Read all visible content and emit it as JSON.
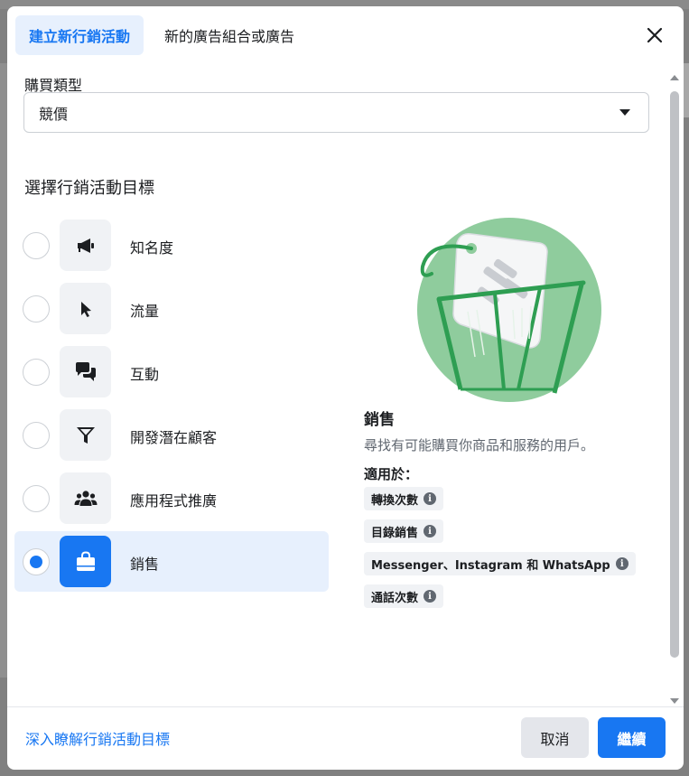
{
  "tabs": [
    {
      "label": "建立新行銷活動",
      "active": true
    },
    {
      "label": "新的廣告組合或廣告",
      "active": false
    }
  ],
  "buy_type": {
    "label": "購買類型",
    "value": "競價"
  },
  "objective_section": {
    "title": "選擇行銷活動目標",
    "items": [
      {
        "label": "知名度",
        "icon": "megaphone-icon",
        "selected": false
      },
      {
        "label": "流量",
        "icon": "cursor-icon",
        "selected": false
      },
      {
        "label": "互動",
        "icon": "chat-bubbles-icon",
        "selected": false
      },
      {
        "label": "開發潛在顧客",
        "icon": "funnel-icon",
        "selected": false
      },
      {
        "label": "應用程式推廣",
        "icon": "people-icon",
        "selected": false
      },
      {
        "label": "銷售",
        "icon": "shopping-bag-icon",
        "selected": true
      }
    ]
  },
  "description": {
    "title": "銷售",
    "text": "尋找有可能購買你商品和服務的用戶。",
    "applies_label": "適用於：",
    "chips": [
      "轉換次數",
      "目錄銷售",
      "Messenger、Instagram 和 WhatsApp",
      "通話次數"
    ]
  },
  "footer": {
    "learn_link": "深入瞭解行銷活動目標",
    "cancel_label": "取消",
    "continue_label": "繼續"
  },
  "colors": {
    "accent": "#1877f2",
    "accent_light": "#e7f0fd",
    "illustration_green": "#8fcc9d",
    "illustration_dark_green": "#2e9e52"
  }
}
